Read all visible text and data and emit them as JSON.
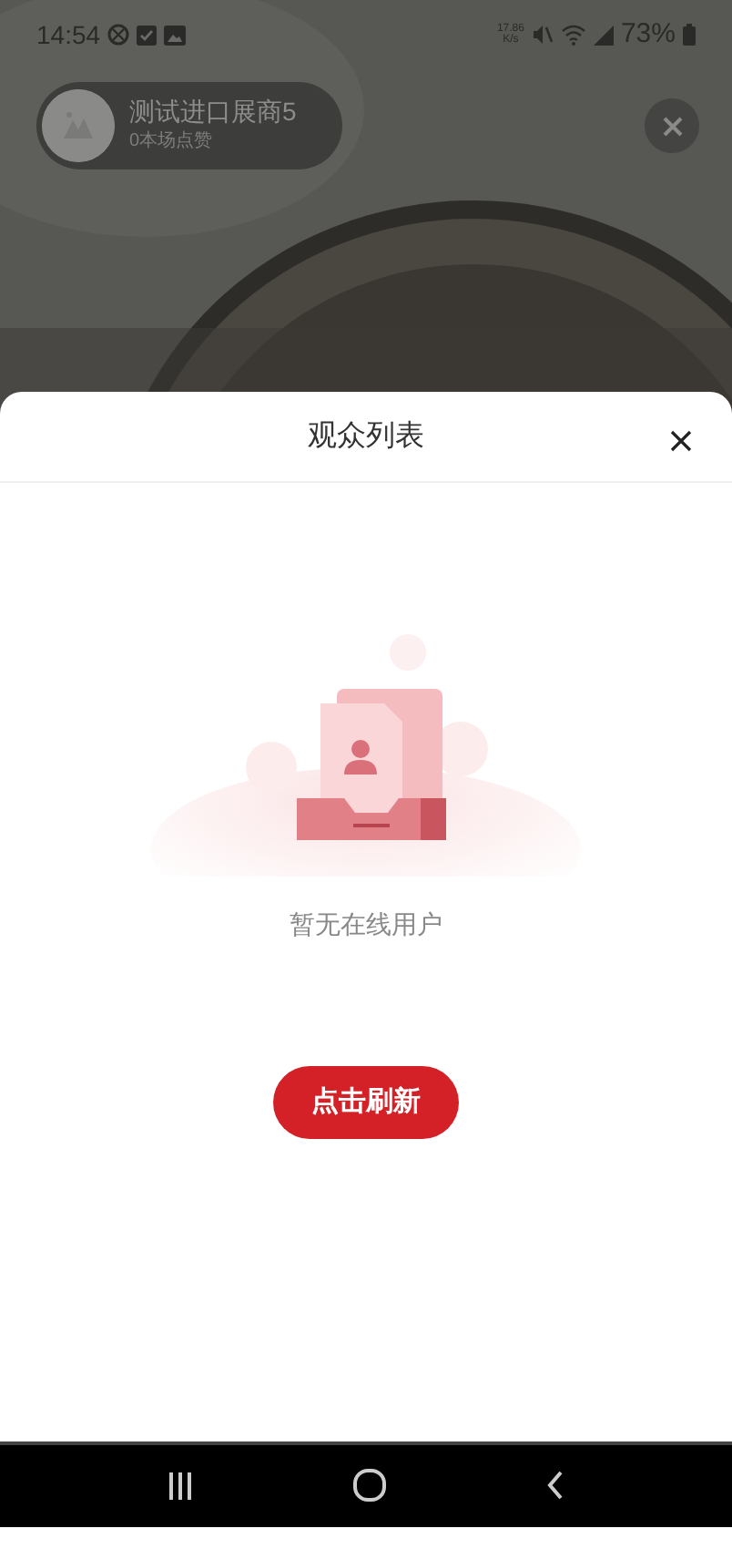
{
  "status_bar": {
    "time": "14:54",
    "net_speed_value": "17.86",
    "net_speed_unit": "K/s",
    "battery": "73%"
  },
  "host": {
    "name": "测试进口展商5",
    "likes": "0本场点赞"
  },
  "sheet": {
    "title": "观众列表",
    "empty_message": "暂无在线用户",
    "refresh_button": "点击刷新"
  }
}
